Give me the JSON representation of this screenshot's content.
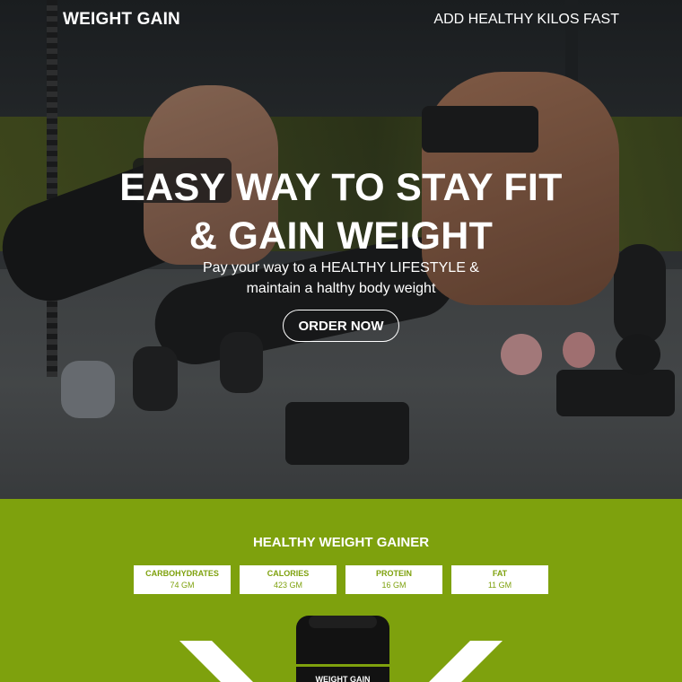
{
  "header": {
    "logo": "WEIGHT GAIN",
    "tagline": "ADD HEALTHY KILOS FAST"
  },
  "hero": {
    "title_line1": "EASY WAY TO STAY FIT",
    "title_line2": "& GAIN WEIGHT",
    "subtitle_line1": "Pay your way to a HEALTHY LIFESTYLE &",
    "subtitle_line2": "maintain a halthy body weight",
    "cta_label": "ORDER NOW"
  },
  "nutrition": {
    "title": "HEALTHY WEIGHT GAINER",
    "items": [
      {
        "name": "CARBOHYDRATES",
        "value": "74 GM"
      },
      {
        "name": "CALORIES",
        "value": "423 GM"
      },
      {
        "name": "PROTEIN",
        "value": "16 GM"
      },
      {
        "name": "FAT",
        "value": "11 GM"
      }
    ],
    "product_label": "WEIGHT GAIN"
  },
  "colors": {
    "accent": "#7ea10d",
    "text_light": "#ffffff"
  }
}
